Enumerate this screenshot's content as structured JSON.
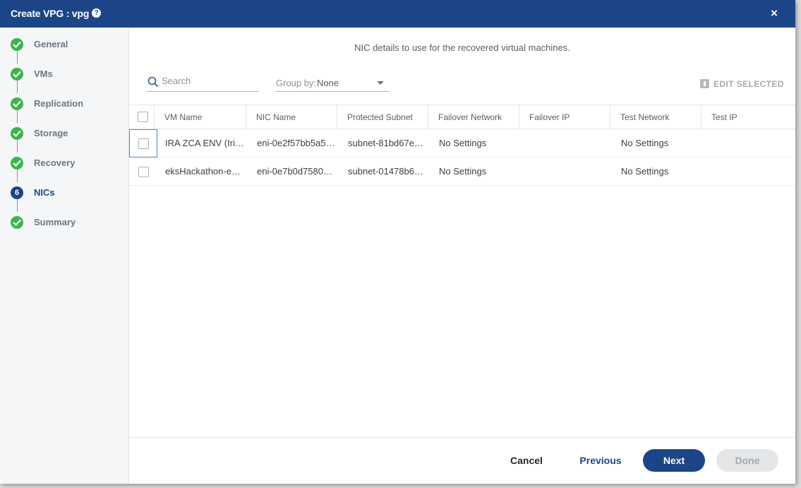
{
  "dialog": {
    "title": "Create VPG : vpg",
    "help_icon": "?",
    "close_icon": "×"
  },
  "steps": [
    {
      "label": "General",
      "state": "done"
    },
    {
      "label": "VMs",
      "state": "done"
    },
    {
      "label": "Replication",
      "state": "done"
    },
    {
      "label": "Storage",
      "state": "done"
    },
    {
      "label": "Recovery",
      "state": "done"
    },
    {
      "label": "NICs",
      "state": "current",
      "number": "6"
    },
    {
      "label": "Summary",
      "state": "done"
    }
  ],
  "main": {
    "hint": "NIC details to use for the recovered virtual machines.",
    "search": {
      "placeholder": "Search"
    },
    "group_by": {
      "label": "Group by:",
      "value": "None"
    },
    "edit_selected": "EDIT SELECTED"
  },
  "table": {
    "columns": [
      "VM Name",
      "NIC Name",
      "Protected Subnet",
      "Failover Network",
      "Failover IP",
      "Test Network",
      "Test IP"
    ],
    "rows": [
      [
        "IRA ZCA ENV (Iri…",
        "eni-0e2f57bb5a5…",
        "subnet-81bd67e…",
        "No Settings",
        "",
        "No Settings",
        ""
      ],
      [
        "eksHackathon-e…",
        "eni-0e7b0d7580…",
        "subnet-01478b6…",
        "No Settings",
        "",
        "No Settings",
        ""
      ]
    ]
  },
  "footer": {
    "cancel": "Cancel",
    "previous": "Previous",
    "next": "Next",
    "done": "Done"
  },
  "colors": {
    "brand": "#1b4587",
    "step_done": "#3bb54a"
  }
}
